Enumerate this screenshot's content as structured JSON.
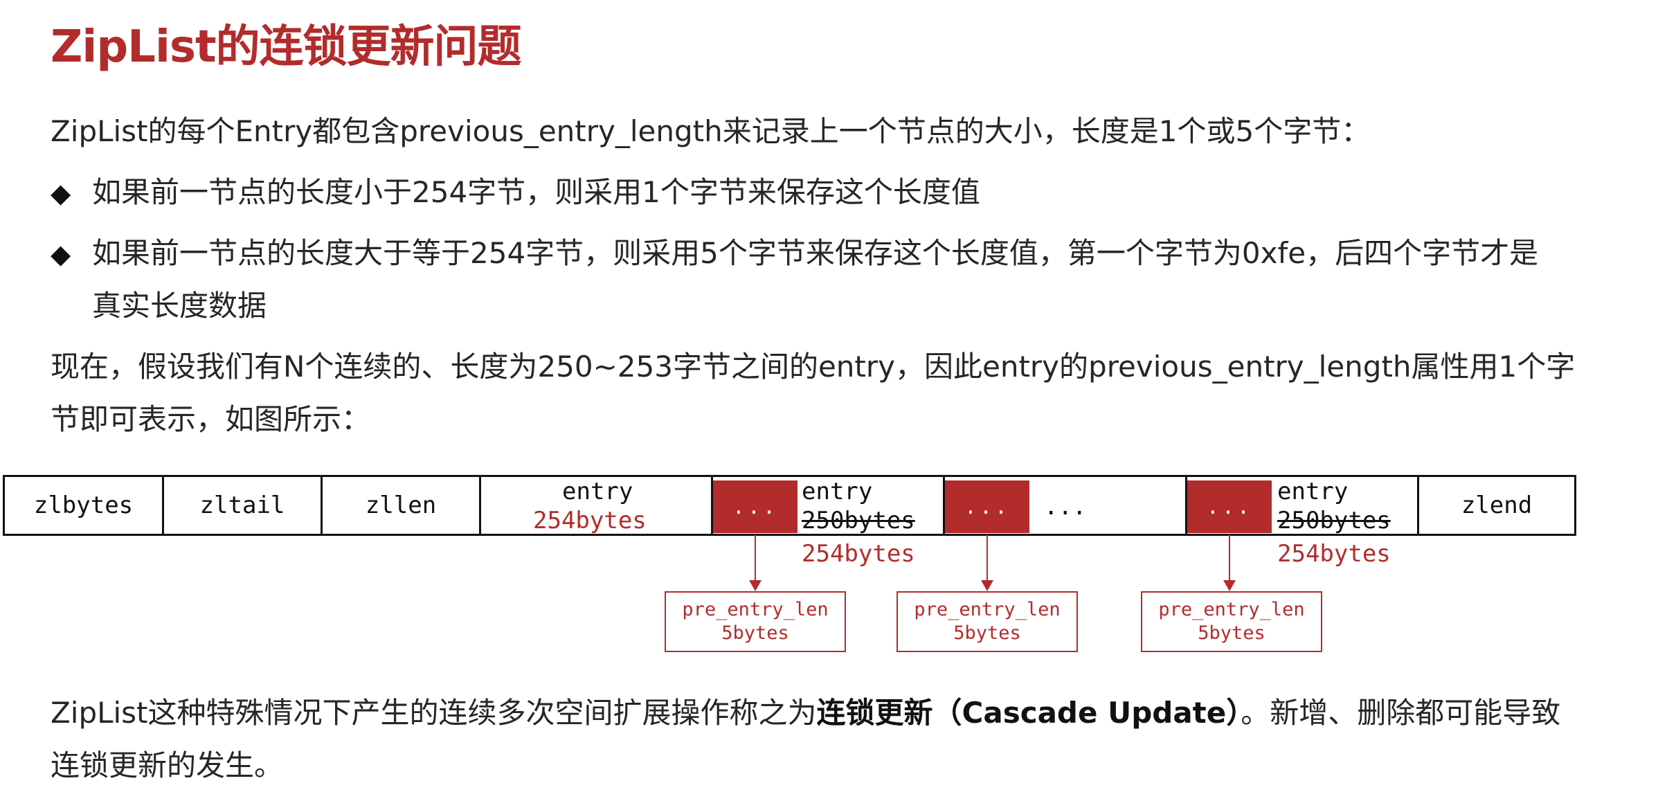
{
  "title": "ZipList的连锁更新问题",
  "intro": "ZipList的每个Entry都包含previous_entry_length来记录上一个节点的大小，长度是1个或5个字节：",
  "bullets": [
    {
      "marker": "◆",
      "text": "如果前一节点的长度小于254字节，则采用1个字节来保存这个长度值"
    },
    {
      "marker": "◆",
      "text": "如果前一节点的长度大于等于254字节，则采用5个字节来保存这个长度值，第一个字节为0xfe，后四个字节才是",
      "cont": "真实长度数据"
    }
  ],
  "assumption": {
    "line1": "现在，假设我们有N个连续的、长度为250~253字节之间的entry，因此entry的previous_entry_length属性用1个字",
    "line2": "节即可表示，如图所示："
  },
  "diagram": {
    "header_cells": [
      "zlbytes",
      "zltail",
      "zllen"
    ],
    "first_entry": {
      "label": "entry",
      "size": "254bytes"
    },
    "entries": [
      {
        "block": "...",
        "label": "entry",
        "old_size": "250bytes",
        "new_size": "254bytes",
        "pre_label": "pre_entry_len",
        "pre_size": "5bytes"
      },
      {
        "block": "...",
        "label": "...",
        "pre_label": "pre_entry_len",
        "pre_size": "5bytes"
      },
      {
        "block": "...",
        "label": "entry",
        "old_size": "250bytes",
        "new_size": "254bytes",
        "pre_label": "pre_entry_len",
        "pre_size": "5bytes"
      }
    ],
    "end_cell": "zlend"
  },
  "conclusion": {
    "prefix": "ZipList这种特殊情况下产生的连续多次空间扩展操作称之为",
    "bold": "连锁更新（Cascade Update）",
    "suffix": "。新增、删除都可能导致",
    "line2": "连锁更新的发生。"
  },
  "colors": {
    "accent": "#b22c2c",
    "text": "#262626",
    "border": "#111111"
  }
}
